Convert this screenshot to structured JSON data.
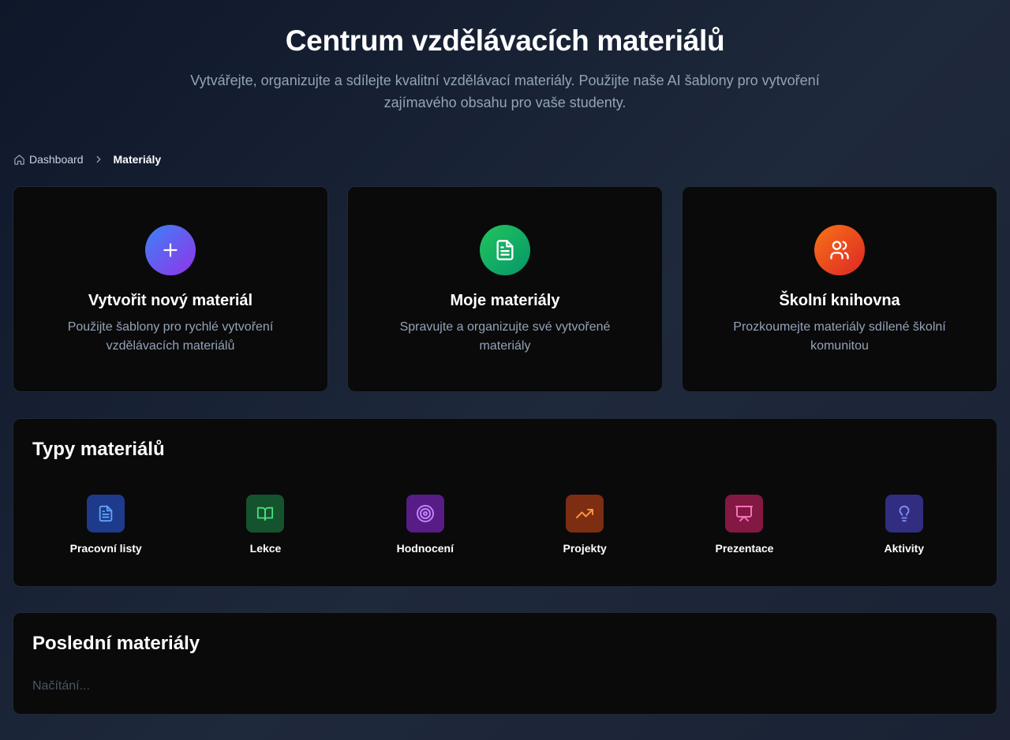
{
  "header": {
    "title": "Centrum vzdělávacích materiálů",
    "subtitle": "Vytvářejte, organizujte a sdílejte kvalitní vzdělávací materiály. Použijte naše AI šablony pro vytvoření zajímavého obsahu pro vaše studenty."
  },
  "breadcrumb": {
    "home": "Dashboard",
    "current": "Materiály"
  },
  "cards": [
    {
      "title": "Vytvořit nový materiál",
      "description": "Použijte šablony pro rychlé vytvoření vzdělávacích materiálů",
      "icon": "plus-icon"
    },
    {
      "title": "Moje materiály",
      "description": "Spravujte a organizujte své vytvořené materiály",
      "icon": "document-icon"
    },
    {
      "title": "Školní knihovna",
      "description": "Prozkoumejte materiály sdílené školní komunitou",
      "icon": "users-icon"
    }
  ],
  "types": {
    "title": "Typy materiálů",
    "items": [
      {
        "label": "Pracovní listy",
        "icon": "document-icon",
        "color": "#60a5fa"
      },
      {
        "label": "Lekce",
        "icon": "book-open-icon",
        "color": "#4ade80"
      },
      {
        "label": "Hodnocení",
        "icon": "target-icon",
        "color": "#c084fc"
      },
      {
        "label": "Projekty",
        "icon": "trending-up-icon",
        "color": "#fb923c"
      },
      {
        "label": "Prezentace",
        "icon": "presentation-icon",
        "color": "#f472b6"
      },
      {
        "label": "Aktivity",
        "icon": "lightbulb-icon",
        "color": "#818cf8"
      }
    ]
  },
  "recent": {
    "title": "Poslední materiály",
    "loading": "Načítání..."
  }
}
